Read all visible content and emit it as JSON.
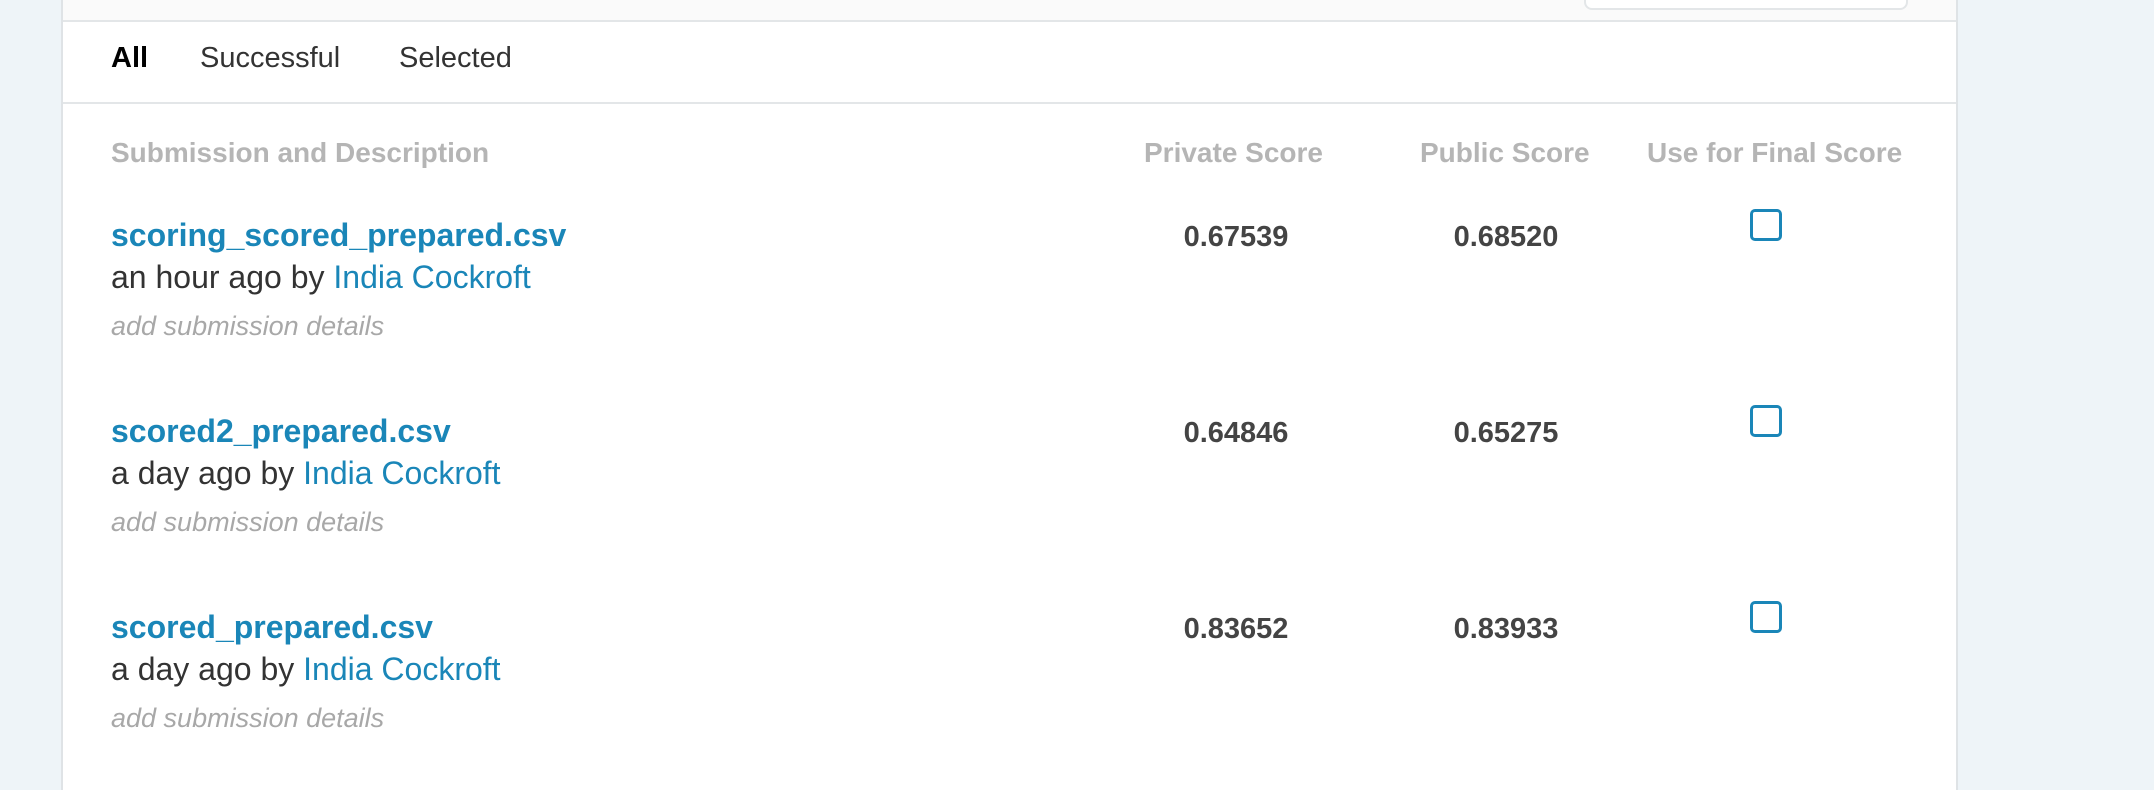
{
  "tabs": [
    {
      "label": "All",
      "active": true
    },
    {
      "label": "Successful",
      "active": false
    },
    {
      "label": "Selected",
      "active": false
    }
  ],
  "table": {
    "headers": {
      "submission": "Submission and Description",
      "private": "Private Score",
      "public": "Public Score",
      "final": "Use for Final Score"
    },
    "rows": [
      {
        "filename": "scoring_scored_prepared.csv",
        "time": "an hour ago by",
        "author": "India Cockroft",
        "details": "add submission details",
        "private_score": "0.67539",
        "public_score": "0.68520",
        "use_for_final": false
      },
      {
        "filename": "scored2_prepared.csv",
        "time": "a day ago by",
        "author": "India Cockroft",
        "details": "add submission details",
        "private_score": "0.64846",
        "public_score": "0.65275",
        "use_for_final": false
      },
      {
        "filename": "scored_prepared.csv",
        "time": "a day ago by",
        "author": "India Cockroft",
        "details": "add submission details",
        "private_score": "0.83652",
        "public_score": "0.83933",
        "use_for_final": false
      }
    ]
  },
  "colors": {
    "link": "#1a86b8",
    "header_text": "#b5b5b5",
    "page_background": "#eef4f8"
  }
}
